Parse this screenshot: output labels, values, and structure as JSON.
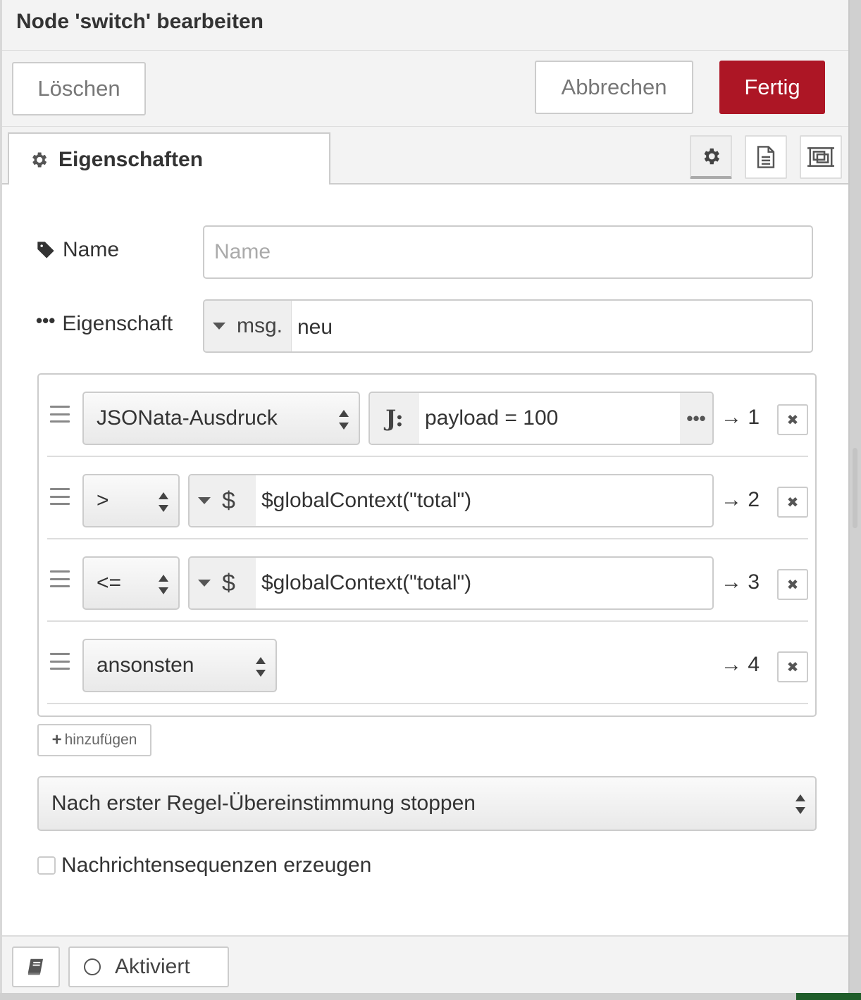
{
  "dialog": {
    "title": "Node 'switch' bearbeiten"
  },
  "toolbar": {
    "delete_label": "Löschen",
    "cancel_label": "Abbrechen",
    "done_label": "Fertig",
    "done_color": "#ad1625"
  },
  "tabs": {
    "properties_label": "Eigenschaften",
    "icons": [
      "gear-icon",
      "document-icon",
      "appearance-icon"
    ]
  },
  "form": {
    "name_label": "Name",
    "name_placeholder": "Name",
    "name_value": "",
    "property_label": "Eigenschaft",
    "property_type": "msg.",
    "property_value": "neu"
  },
  "rules": [
    {
      "operator": "JSONata-Ausdruck",
      "value_type_icon": "jsonata-icon",
      "value": "payload = 100",
      "output": "→ 1"
    },
    {
      "operator": ">",
      "value_type_icon": "dollar-icon",
      "value_type": "$",
      "value": "$globalContext(\"total\")",
      "output": "→ 2"
    },
    {
      "operator": "<=",
      "value_type_icon": "dollar-icon",
      "value_type": "$",
      "value": "$globalContext(\"total\")",
      "output": "→ 3"
    },
    {
      "operator": "ansonsten",
      "output": "→ 4"
    }
  ],
  "add_rule_label": "hinzufügen",
  "checking_mode": "Nach erster Regel-Übereinstimmung stoppen",
  "sequence_label": "Nachrichtensequenzen erzeugen",
  "sequence_checked": false,
  "footer": {
    "enabled_label": "Aktiviert"
  }
}
